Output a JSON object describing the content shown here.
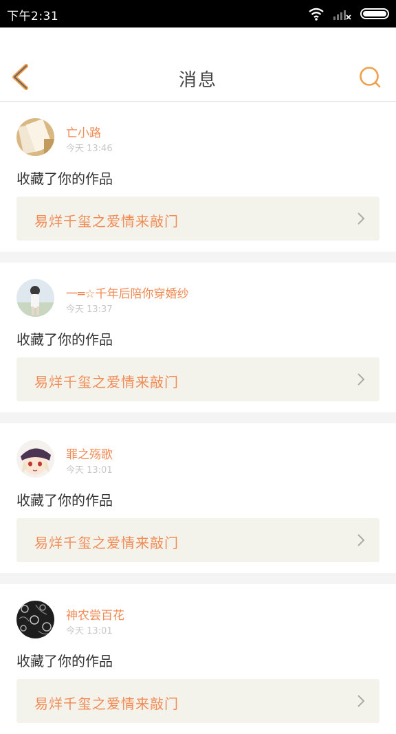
{
  "status_bar": {
    "time": "下午2:31"
  },
  "header": {
    "title": "消息",
    "back_icon": "chevron-left-icon",
    "search_icon": "search-icon",
    "accent": "#f0a04b"
  },
  "messages": [
    {
      "username": "亡小路",
      "time": "今天 13:46",
      "action": "收藏了你的作品",
      "work_title": "易烊千玺之爱情来敲门"
    },
    {
      "username": "一═☆千年后陪你穿婚纱",
      "time": "今天 13:37",
      "action": "收藏了你的作品",
      "work_title": "易烊千玺之爱情来敲门"
    },
    {
      "username": "罪之殇歌",
      "time": "今天 13:01",
      "action": "收藏了你的作品",
      "work_title": "易烊千玺之爱情来敲门"
    },
    {
      "username": "神农尝百花",
      "time": "今天 13:01",
      "action": "收藏了你的作品",
      "work_title": "易烊千玺之爱情来敲门"
    }
  ]
}
